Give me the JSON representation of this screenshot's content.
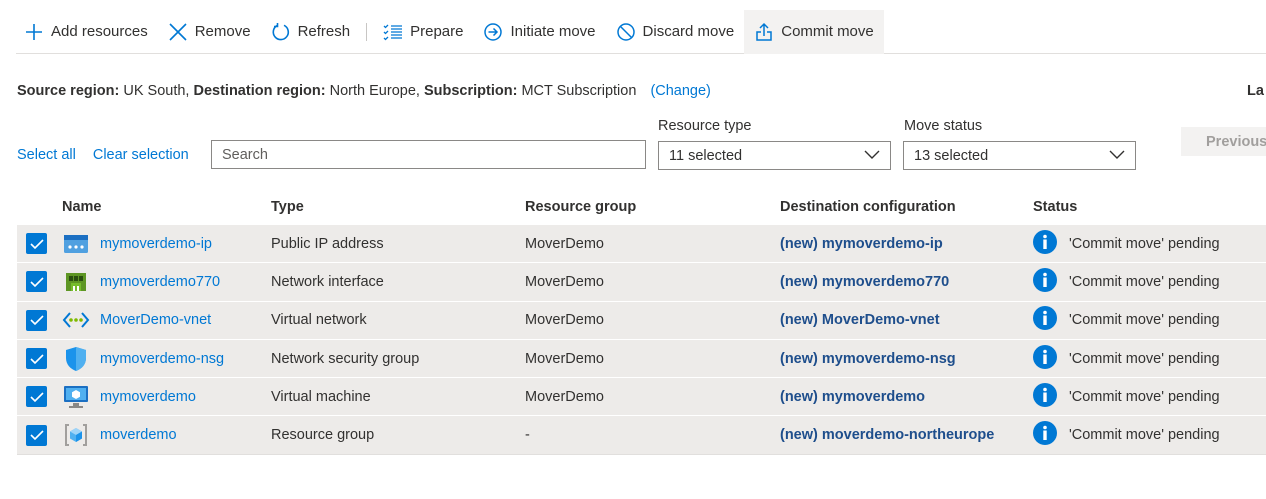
{
  "toolbar": {
    "add": "Add resources",
    "remove": "Remove",
    "refresh": "Refresh",
    "prepare": "Prepare",
    "initiate": "Initiate move",
    "discard": "Discard move",
    "commit": "Commit move"
  },
  "region": {
    "source_label": "Source region:",
    "source_value": "UK South,",
    "dest_label": "Destination region:",
    "dest_value": "North Europe,",
    "sub_label": "Subscription:",
    "sub_value": "MCT Subscription",
    "change": "(Change)",
    "last": "La"
  },
  "filters": {
    "select_all": "Select all",
    "clear_selection": "Clear selection",
    "search_placeholder": "Search",
    "resource_type_label": "Resource type",
    "resource_type_value": "11 selected",
    "move_status_label": "Move status",
    "move_status_value": "13 selected",
    "previous": "Previous"
  },
  "table": {
    "headers": {
      "name": "Name",
      "type": "Type",
      "rg": "Resource group",
      "dest": "Destination configuration",
      "status": "Status"
    },
    "rows": [
      {
        "name": "mymoverdemo-ip",
        "type": "Public IP address",
        "rg": "MoverDemo",
        "dest": "(new) mymoverdemo-ip",
        "status": "'Commit move' pending",
        "icon": "public-ip-icon"
      },
      {
        "name": "mymoverdemo770",
        "type": "Network interface",
        "rg": "MoverDemo",
        "dest": "(new) mymoverdemo770",
        "status": "'Commit move' pending",
        "icon": "network-interface-icon"
      },
      {
        "name": "MoverDemo-vnet",
        "type": "Virtual network",
        "rg": "MoverDemo",
        "dest": "(new) MoverDemo-vnet",
        "status": "'Commit move' pending",
        "icon": "virtual-network-icon"
      },
      {
        "name": "mymoverdemo-nsg",
        "type": "Network security group",
        "rg": "MoverDemo",
        "dest": "(new) mymoverdemo-nsg",
        "status": "'Commit move' pending",
        "icon": "shield-icon"
      },
      {
        "name": "mymoverdemo",
        "type": "Virtual machine",
        "rg": "MoverDemo",
        "dest": "(new) mymoverdemo",
        "status": "'Commit move' pending",
        "icon": "virtual-machine-icon"
      },
      {
        "name": "moverdemo",
        "type": "Resource group",
        "rg": "-",
        "dest": "(new) moverdemo-northeurope",
        "status": "'Commit move' pending",
        "icon": "resource-group-icon"
      }
    ]
  },
  "colors": {
    "accent": "#0078d4",
    "row_bg": "#edebe9",
    "dest_text": "#1e4e8c"
  }
}
